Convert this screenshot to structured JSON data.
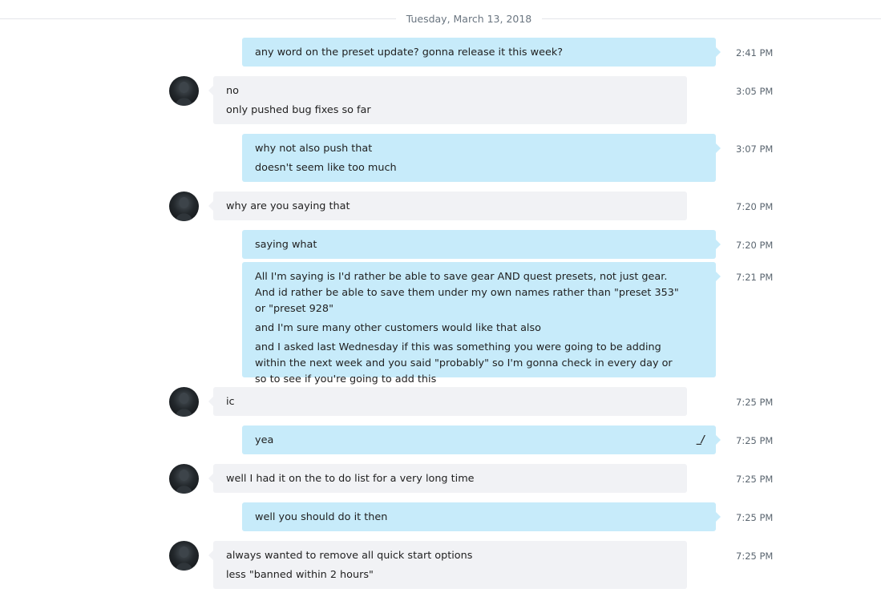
{
  "date_separator": "Tuesday, March 13, 2018",
  "messages": [
    {
      "side": "out",
      "lines": [
        "any word on the preset update? gonna release it this week?"
      ],
      "time": "2:41 PM"
    },
    {
      "side": "in",
      "lines": [
        "no",
        "only pushed bug fixes so far"
      ],
      "time": "3:05 PM"
    },
    {
      "side": "out",
      "lines": [
        "why not also push that",
        "doesn't seem like too much"
      ],
      "time": "3:07 PM"
    },
    {
      "side": "in",
      "lines": [
        "why are you saying that"
      ],
      "time": "7:20 PM"
    },
    {
      "side": "out",
      "lines": [
        "saying what"
      ],
      "time": "7:20 PM"
    },
    {
      "side": "out",
      "lines": [
        "All I'm saying is I'd rather be able to save gear AND quest presets, not just gear. And id rather be able to save them under my own names rather than \"preset 353\" or \"preset 928\"",
        "and I'm sure many other customers would like that also",
        "and I asked last Wednesday if this was something you were going to be adding within the next week and you said \"probably\" so I'm gonna check in every day or so to see if you're going to add this"
      ],
      "time": "7:21 PM"
    },
    {
      "side": "in",
      "lines": [
        "ic"
      ],
      "time": "7:25 PM"
    },
    {
      "side": "out",
      "lines": [
        "yea"
      ],
      "time": "7:25 PM",
      "edited_icon": "edit-pencil-icon"
    },
    {
      "side": "in",
      "lines": [
        "well I had it on the to do list for a very long time"
      ],
      "time": "7:25 PM"
    },
    {
      "side": "out",
      "lines": [
        "well you should do it then"
      ],
      "time": "7:25 PM"
    },
    {
      "side": "in",
      "lines": [
        "always wanted to remove all quick start options",
        "less \"banned within 2 hours\""
      ],
      "time": "7:25 PM"
    }
  ],
  "colors": {
    "outgoing_bubble": "#c7ebfa",
    "incoming_bubble": "#f1f2f5",
    "timestamp": "#5b6670"
  }
}
